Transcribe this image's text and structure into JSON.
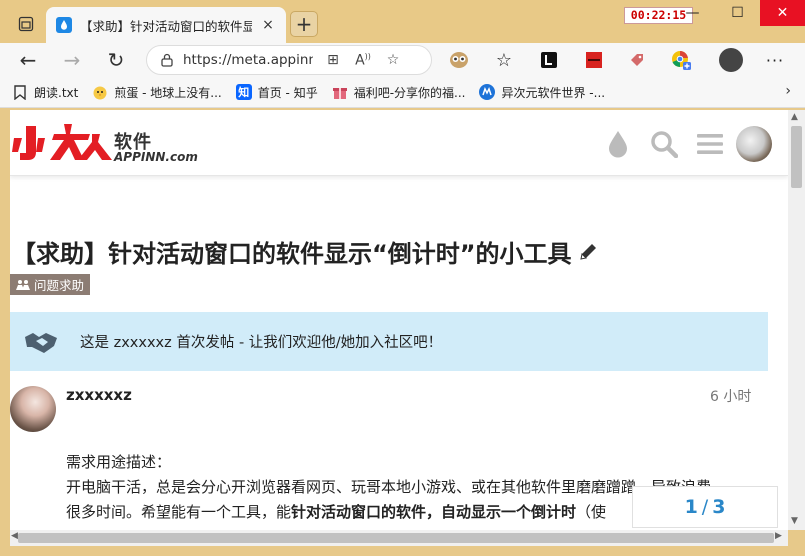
{
  "browser": {
    "tab": {
      "title": "【求助】针对活动窗口的软件显示",
      "close": "×"
    },
    "new_tab": "+",
    "clock": "00:22:15",
    "window_buttons": {
      "minimize": "—",
      "maximize": "☐",
      "close": "✕"
    },
    "address": {
      "url": "https://meta.appinn..."
    },
    "nav": {
      "back": "←",
      "forward": "→",
      "refresh": "↻"
    }
  },
  "bookmarks": [
    {
      "label": "朗读.txt",
      "icon": "bookmark-icon",
      "color": "#333333"
    },
    {
      "label": "煎蛋 - 地球上没有...",
      "icon": "egg-chick-icon",
      "color": "#f2b705"
    },
    {
      "label": "首页 - 知乎",
      "icon": "zhihu-icon",
      "color": "#0a66ff"
    },
    {
      "label": "福利吧-分享你的福...",
      "icon": "gift-icon",
      "color": "#d9534f"
    },
    {
      "label": "异次元软件世界 -...",
      "icon": "iplaysoft-icon",
      "color": "#1e73d8"
    }
  ],
  "site": {
    "logo_cn": "软件",
    "logo_en": "APPINN.com",
    "brand_color": "#e31e24"
  },
  "topic": {
    "title": "【求助】针对活动窗口的软件显示“倒计时”的小工具",
    "category": "问题求助",
    "category_color": "#8c7c73"
  },
  "notice": {
    "text": "这是 zxxxxxz 首次发帖 - 让我们欢迎他/她加入社区吧！"
  },
  "post": {
    "username": "zxxxxxz",
    "time": "6 小时",
    "line1": "需求用途描述：",
    "line2": "开电脑干活，总是会分心开浏览器看网页、玩哥本地小游戏、或在其他软件里磨磨蹭蹭，导致浪费",
    "line3_pre": "很多时间。希望能有一个工具，能",
    "line3_bold": "针对活动窗口的软件，自动显示一个倒计时",
    "line3_post": "（使"
  },
  "progress": {
    "current": "1",
    "separator": "/",
    "total": "3"
  }
}
